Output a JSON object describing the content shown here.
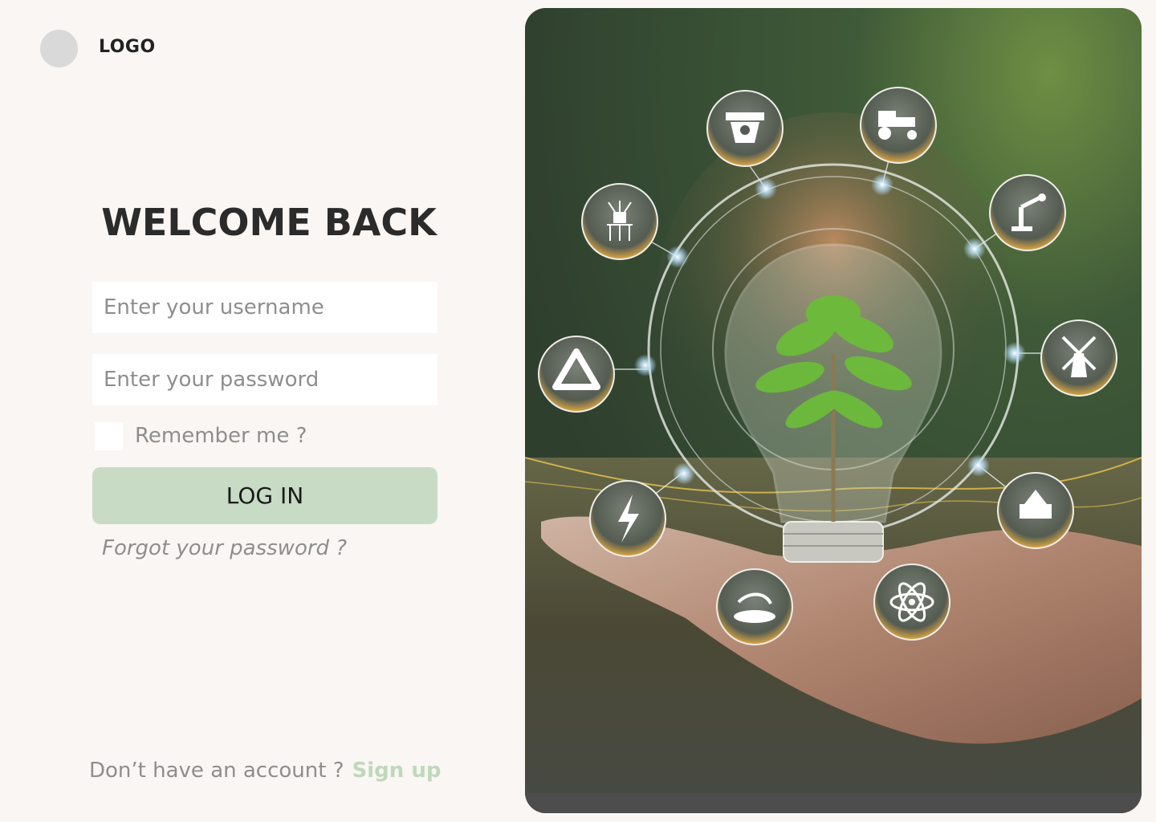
{
  "brand": {
    "logo_text": "LOGO"
  },
  "login": {
    "title": "WELCOME BACK",
    "username_placeholder": "Enter your username",
    "password_placeholder": "Enter your password",
    "remember_label": "Remember me ?",
    "login_button": "LOG IN",
    "forgot_link": "Forgot your password ?"
  },
  "signup": {
    "prompt": "Don’t have an account ?",
    "link": "Sign up"
  },
  "hero": {
    "icons": [
      "smart-camera-icon",
      "tractor-icon",
      "robot-arm-icon",
      "windmill-icon",
      "greenhouse-icon",
      "atom-icon",
      "watering-icon",
      "lightning-icon",
      "recycle-icon",
      "sensor-probe-icon"
    ],
    "colors": {
      "accent": "#c8dcc5",
      "signup_link": "#bfd8bc",
      "background": "#faf6f3"
    }
  }
}
